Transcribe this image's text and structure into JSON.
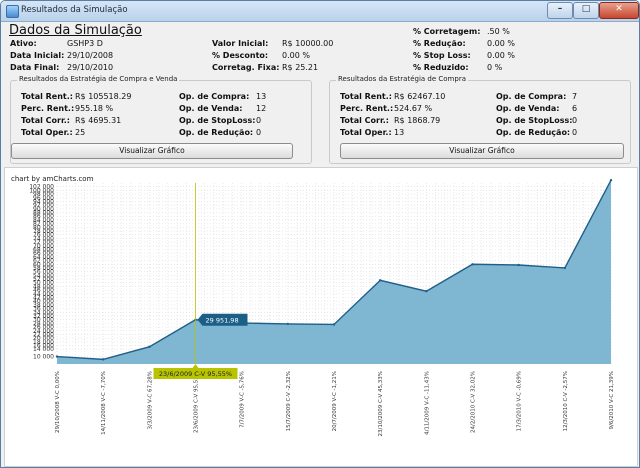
{
  "window": {
    "title": "Resultados da Simulação"
  },
  "summary": {
    "heading": "Dados da Simulação",
    "ativo_label": "Ativo:",
    "ativo": "GSHP3 D",
    "data_inicial_label": "Data Inicial:",
    "data_inicial": "29/10/2008",
    "data_final_label": "Data Final:",
    "data_final": "29/10/2010",
    "valor_inicial_label": "Valor Inicial:",
    "valor_inicial": "R$ 10000.00",
    "desconto_label": "% Desconto:",
    "desconto": "0.00 %",
    "corretagem_fixa_label": "Corretag. Fixa:",
    "corretagem_fixa": "R$ 25.21",
    "pct_corretagem_label": "% Corretagem:",
    "pct_corretagem": ".50 %",
    "pct_reducao_label": "% Redução:",
    "pct_reducao": "0.00 %",
    "pct_stoploss_label": "% Stop Loss:",
    "pct_stoploss": "0.00 %",
    "pct_reduzido_label": "% Reduzido:",
    "pct_reduzido": "0 %"
  },
  "left_group": {
    "title": "Resultados da Estratégia de Compra e Venda",
    "total_rent_label": "Total Rent.:",
    "total_rent": "R$ 105518.29",
    "perc_rent_label": "Perc. Rent.:",
    "perc_rent": "955.18 %",
    "total_corr_label": "Total Corr.:",
    "total_corr": "R$ 4695.31",
    "total_oper_label": "Total Oper.:",
    "total_oper": "25",
    "op_compra_label": "Op. de Compra:",
    "op_compra": "13",
    "op_venda_label": "Op. de Venda:",
    "op_venda": "12",
    "op_stoploss_label": "Op. de StopLoss:",
    "op_stoploss": "0",
    "op_reducao_label": "Op. de Redução:",
    "op_reducao": "0",
    "button": "Visualizar Gráfico"
  },
  "right_group": {
    "title": "Resultados da Estratégia de Compra",
    "total_rent_label": "Total Rent.:",
    "total_rent": "R$ 62467.10",
    "perc_rent_label": "Perc. Rent.:",
    "perc_rent": "524.67 %",
    "total_corr_label": "Total Corr.:",
    "total_corr": "R$ 1868.79",
    "total_oper_label": "Total Oper.:",
    "total_oper": "13",
    "op_compra_label": "Op. de Compra:",
    "op_compra": "7",
    "op_venda_label": "Op. de Venda:",
    "op_venda": "6",
    "op_stoploss_label": "Op. de StopLoss:",
    "op_stoploss": "0",
    "op_reducao_label": "Op. de Redução:",
    "op_reducao": "0",
    "button": "Visualizar Gráfico"
  },
  "chart": {
    "credit": "chart by amCharts.com",
    "tooltip_value": "29 951,98",
    "cursor_label": "23/6/2009 C-V 95,55%",
    "fill_color": "#7fb6d2",
    "line_color": "#1f5f8a",
    "tooltip_color": "#1b5f86",
    "cursor_color": "#b8c400"
  },
  "chart_data": {
    "type": "area",
    "ylim": [
      6000,
      104000
    ],
    "y_ticks": [
      10000,
      14000,
      16000,
      18000,
      20000,
      22000,
      24000,
      26000,
      28000,
      30000,
      32000,
      34000,
      36000,
      38000,
      40000,
      42000,
      44000,
      46000,
      48000,
      50000,
      52000,
      54000,
      56000,
      58000,
      60000,
      62000,
      64000,
      66000,
      68000,
      70000,
      72000,
      74000,
      76000,
      78000,
      80000,
      82000,
      84000,
      86000,
      88000,
      90000,
      92000,
      94000,
      96000,
      98000,
      100000,
      102000
    ],
    "x": [
      "29/10/2008 V-C 0,00%",
      "14/11/2008 V-C -7,70%",
      "3/3/2009 V-C 67,28%",
      "23/6/2009 C-V 95,55%",
      "7/7/2009 V-C -5,76%",
      "15/7/2009 C-V -2,32%",
      "20/7/2009 V-C -1,21%",
      "23/10/2009 C-V 45,33%",
      "4/11/2009 V-C -11,43%",
      "24/2/2010 C-V 32,02%",
      "17/3/2010 V-C -0,69%",
      "12/3/2010 C-V -2,57%",
      "9/6/2010 V-C 21,39%"
    ],
    "values": [
      10000,
      8500,
      15300,
      29952,
      28200,
      27700,
      27400,
      51300,
      45400,
      60000,
      59600,
      58000,
      105518
    ],
    "grid": true
  }
}
